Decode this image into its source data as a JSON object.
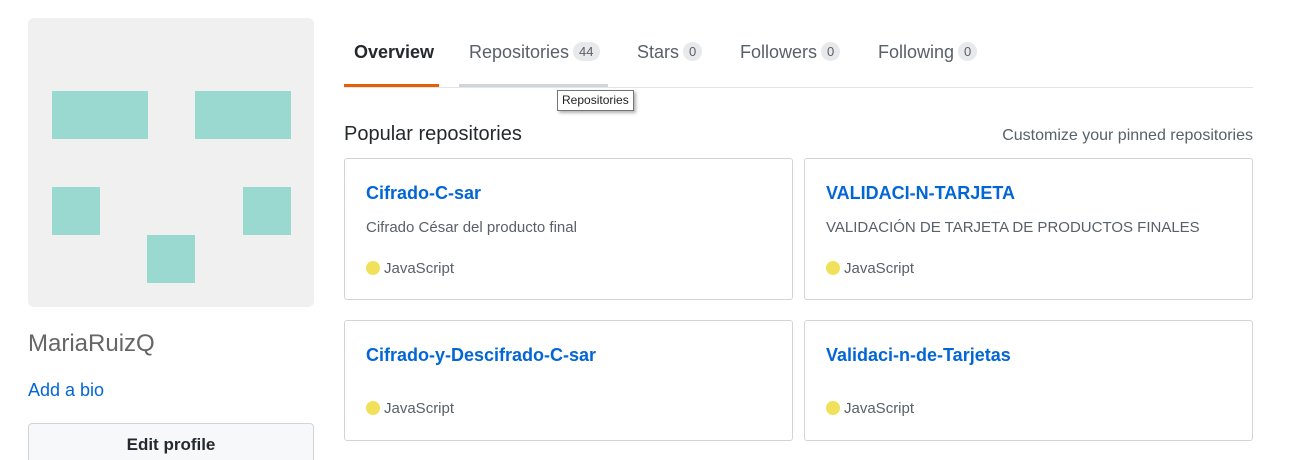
{
  "profile": {
    "username": "MariaRuizQ",
    "bio_link": "Add a bio",
    "edit_button": "Edit profile",
    "avatar_color": "#9ad9cf"
  },
  "tabs": [
    {
      "label": "Overview",
      "count": null,
      "active": true
    },
    {
      "label": "Repositories",
      "count": "44"
    },
    {
      "label": "Stars",
      "count": "0"
    },
    {
      "label": "Followers",
      "count": "0"
    },
    {
      "label": "Following",
      "count": "0"
    }
  ],
  "tooltip": "Repositories",
  "popular": {
    "title": "Popular repositories",
    "customize_link": "Customize your pinned repositories"
  },
  "repos": [
    {
      "name": "Cifrado-C-sar",
      "description": "Cifrado César del producto final",
      "language": "JavaScript",
      "language_color": "#f1e05a"
    },
    {
      "name": "VALIDACI-N-TARJETA",
      "description": "VALIDACIÓN DE TARJETA DE PRODUCTOS FINALES",
      "language": "JavaScript",
      "language_color": "#f1e05a"
    },
    {
      "name": "Cifrado-y-Descifrado-C-sar",
      "description": "",
      "language": "JavaScript",
      "language_color": "#f1e05a"
    },
    {
      "name": "Validaci-n-de-Tarjetas",
      "description": "",
      "language": "JavaScript",
      "language_color": "#f1e05a"
    }
  ]
}
